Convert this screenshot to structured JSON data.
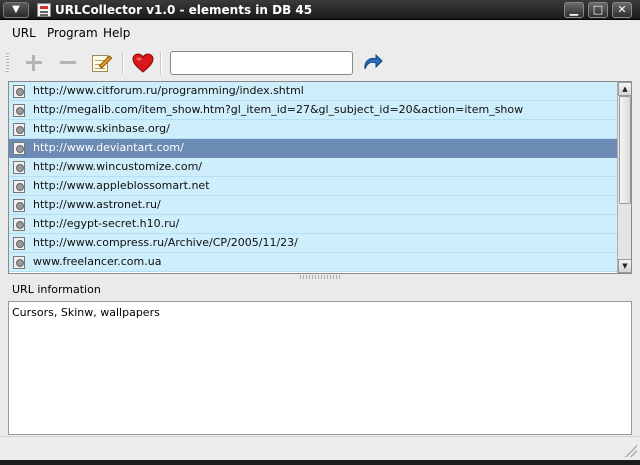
{
  "titlebar": {
    "menu_glyph": "▼",
    "title": "URLCollector v1.0 - elements in DB 45",
    "minimize_glyph": "▁",
    "maximize_glyph": "□",
    "close_glyph": "✕"
  },
  "menu": [
    "URL",
    "Program",
    "Help"
  ],
  "toolbar": {
    "icons": [
      "add-icon",
      "remove-icon",
      "edit-icon",
      "favorite-heart-icon",
      "go-arrow-icon"
    ],
    "url_input_value": "",
    "accent_heart": "#d81818",
    "accent_arrow": "#2a6cc0"
  },
  "list": {
    "rows": [
      "http://www.citforum.ru/programming/index.shtml",
      "http://megalib.com/item_show.htm?gl_item_id=27&gl_subject_id=20&action=item_show",
      "http://www.skinbase.org/",
      "http://www.deviantart.com/",
      "http://www.wincustomize.com/",
      "http://www.appleblossomart.net",
      "http://www.astronet.ru/",
      "http://egypt-secret.h10.ru/",
      "http://www.compress.ru/Archive/CP/2005/11/23/",
      "www.freelancer.com.ua"
    ],
    "selected_index": 3,
    "row_color": "#cdeefa",
    "selected_color": "#6b8bb4",
    "scroll_up_glyph": "▲",
    "scroll_down_glyph": "▼"
  },
  "info": {
    "label": "URL information",
    "text": "Cursors, Skinw, wallpapers"
  }
}
